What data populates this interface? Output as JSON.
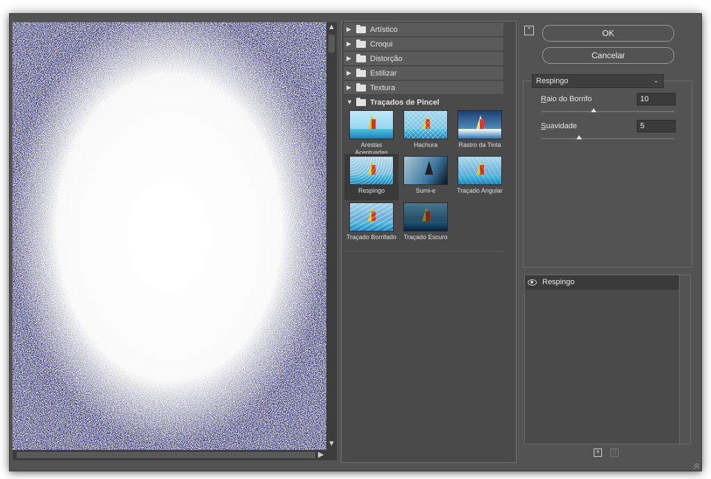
{
  "gallery": {
    "categories": [
      {
        "label": "Artístico",
        "expanded": false
      },
      {
        "label": "Croqui",
        "expanded": false
      },
      {
        "label": "Distorção",
        "expanded": false
      },
      {
        "label": "Estilizar",
        "expanded": false
      },
      {
        "label": "Textura",
        "expanded": false
      },
      {
        "label": "Traçados de Pincel",
        "expanded": true
      }
    ],
    "filters": [
      {
        "label": "Arestas Acentuadas",
        "selected": false
      },
      {
        "label": "Hachura",
        "selected": false
      },
      {
        "label": "Rastro da Tinta",
        "selected": false
      },
      {
        "label": "Respingo",
        "selected": true
      },
      {
        "label": "Sumi-e",
        "selected": false
      },
      {
        "label": "Traçado Angular",
        "selected": false
      },
      {
        "label": "Traçado Borrifado",
        "selected": false
      },
      {
        "label": "Traçado Escuro",
        "selected": false
      }
    ]
  },
  "buttons": {
    "ok": "OK",
    "cancel": "Cancelar"
  },
  "settings": {
    "filter_select": "Respingo",
    "params": [
      {
        "label": "Raio do Borrifo",
        "access_key": "R",
        "value": "10",
        "slider_fraction": 0.4
      },
      {
        "label": "Suavidade",
        "access_key": "S",
        "value": "5",
        "slider_fraction": 0.3
      }
    ]
  },
  "layers": {
    "items": [
      {
        "name": "Respingo",
        "visible": true
      }
    ]
  },
  "icons": {
    "collapse": "collapse-up-icon",
    "new_layer": "new-effect-layer-icon",
    "delete": "trash-icon",
    "visibility": "eye-icon",
    "folder": "folder-icon"
  }
}
